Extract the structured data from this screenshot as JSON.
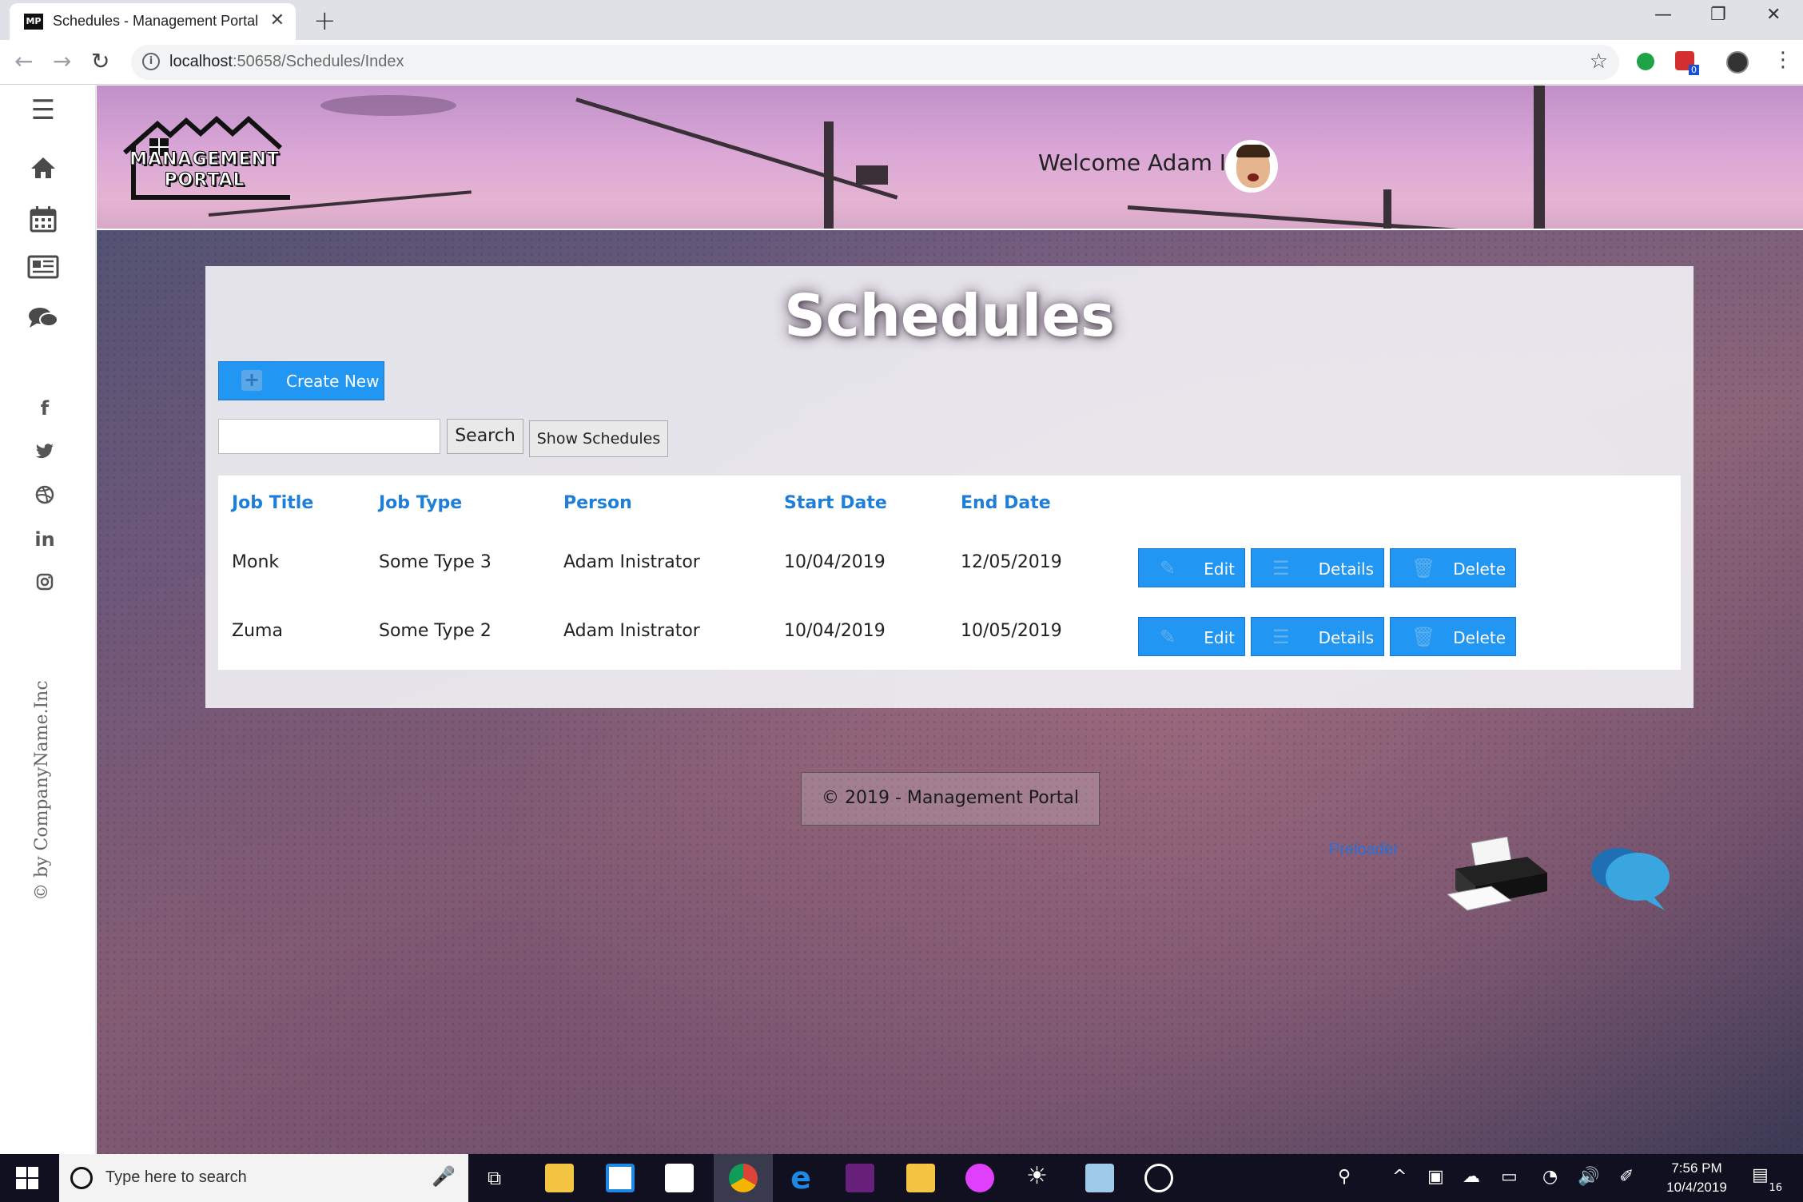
{
  "browser": {
    "tab_title": "Schedules - Management Portal",
    "favicon_text": "MP",
    "url_host": "localhost",
    "url_rest": ":50658/Schedules/Index",
    "extension_badge": "0"
  },
  "sidebar": {
    "copyright": "© by CompanyName.Inc",
    "icons": [
      "menu-icon",
      "home-icon",
      "calendar-icon",
      "newspaper-icon",
      "chat-icon"
    ],
    "social": [
      "facebook-icon",
      "twitter-icon",
      "dribbble-icon",
      "linkedin-icon",
      "instagram-icon"
    ]
  },
  "header": {
    "logo_line1": "MANAGEMENT",
    "logo_line2": "PORTAL",
    "welcome": "Welcome Adam I"
  },
  "main": {
    "title": "Schedules",
    "create_label": "Create New",
    "search_value": "",
    "search_label": "Search",
    "show_label": "Show Schedules",
    "columns": [
      "Job Title",
      "Job Type",
      "Person",
      "Start Date",
      "End Date"
    ],
    "rows": [
      {
        "job_title": "Monk",
        "job_type": "Some Type 3",
        "person": "Adam Inistrator",
        "start": "10/04/2019",
        "end": "12/05/2019"
      },
      {
        "job_title": "Zuma",
        "job_type": "Some Type 2",
        "person": "Adam Inistrator",
        "start": "10/04/2019",
        "end": "10/05/2019"
      }
    ],
    "actions": {
      "edit": "Edit",
      "details": "Details",
      "delete": "Delete"
    }
  },
  "footer": {
    "copyright": "© 2019 - Management Portal",
    "preloader": "Preloader"
  },
  "taskbar": {
    "search_placeholder": "Type here to search",
    "time": "7:56 PM",
    "date": "10/4/2019",
    "notifications": "16"
  },
  "colors": {
    "accent": "#2196f3",
    "header_text": "#1f7fd8"
  }
}
